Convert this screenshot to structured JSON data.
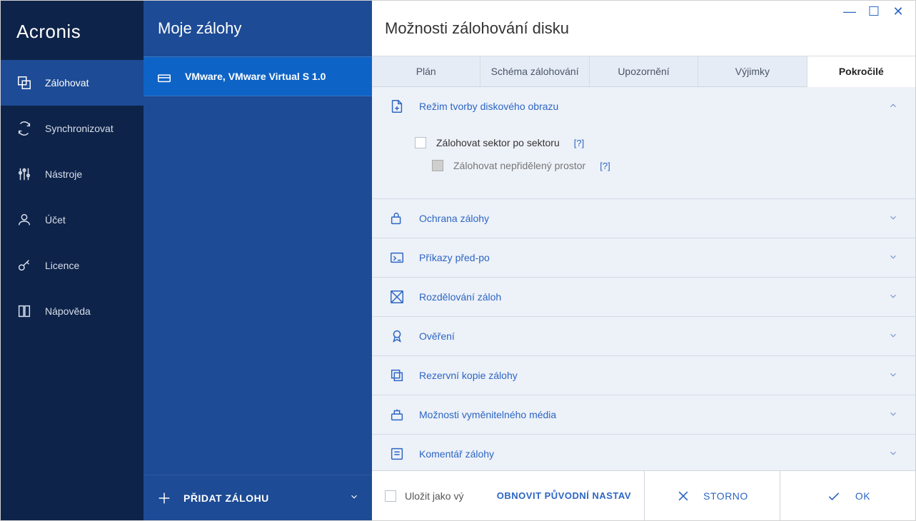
{
  "brand": "Acronis",
  "nav": [
    {
      "label": "Zálohovat"
    },
    {
      "label": "Synchronizovat"
    },
    {
      "label": "Nástroje"
    },
    {
      "label": "Účet"
    },
    {
      "label": "Licence"
    },
    {
      "label": "Nápověda"
    }
  ],
  "middle": {
    "header": "Moje zálohy",
    "backup_name": "VMware, VMware Virtual S 1.0",
    "add_label": "PŘIDAT ZÁLOHU"
  },
  "panel": {
    "title": "Možnosti zálohování disku",
    "tabs": [
      "Plán",
      "Schéma zálohování",
      "Upozornění",
      "Výjimky",
      "Pokročilé"
    ],
    "active_tab": 4
  },
  "sections": {
    "image_mode": {
      "title": "Režim tvorby diskového obrazu",
      "cb1": "Zálohovat sektor po sektoru",
      "cb2": "Zálohovat nepřidělený prostor",
      "help": "[?]"
    },
    "protection": "Ochrana zálohy",
    "prepost": "Příkazy před-po",
    "split": "Rozdělování záloh",
    "verify": "Ověření",
    "reserve": "Rezervní kopie zálohy",
    "removable": "Možnosti vyměnitelného média",
    "comment": "Komentář zálohy"
  },
  "footer": {
    "save_as": "Uložit jako vý",
    "reset": "OBNOVIT PŮVODNÍ NASTAV",
    "cancel": "STORNO",
    "ok": "OK"
  }
}
